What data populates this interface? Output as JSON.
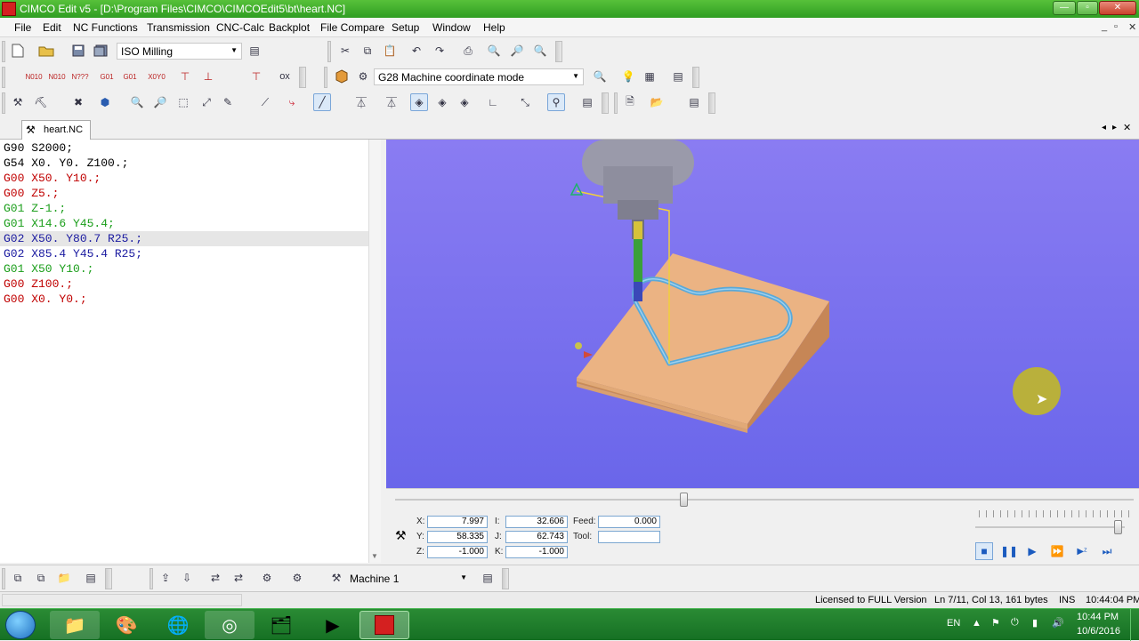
{
  "window": {
    "title": "CIMCO Edit v5 - [D:\\Program Files\\CIMCO\\CIMCOEdit5\\bt\\heart.NC]",
    "controls": [
      "—",
      "▫",
      "✕"
    ]
  },
  "menu": [
    "File",
    "Edit",
    "NC Functions",
    "Transmission",
    "CNC-Calc",
    "Backplot",
    "File Compare",
    "Setup",
    "Window",
    "Help"
  ],
  "mdi_controls": [
    "_",
    "▫",
    "✕"
  ],
  "toolbar1": {
    "mode_select": "ISO Milling"
  },
  "toolbar2": {
    "coord_select": "G28 Machine coordinate mode",
    "ox_label": "ox"
  },
  "doctab": {
    "name": "heart.NC",
    "nav": [
      "◂",
      "▸",
      "✕"
    ]
  },
  "code_lines": [
    {
      "text": "G90 S2000;",
      "color": "#000000"
    },
    {
      "text": "G54 X0. Y0. Z100.;",
      "color": "#000000"
    },
    {
      "text": "G00 X50. Y10.;",
      "color": "#c00000"
    },
    {
      "text": "G00 Z5.;",
      "color": "#c00000"
    },
    {
      "text": "G01 Z-1.;",
      "color": "#1a9e1a"
    },
    {
      "text": "G01 X14.6 Y45.4;",
      "color": "#1a9e1a"
    },
    {
      "text": "G02 X50. Y80.7 R25.;",
      "color": "#1a1aa0"
    },
    {
      "text": "G02 X85.4 Y45.4 R25;",
      "color": "#1a1aa0"
    },
    {
      "text": "G01 X50 Y10.;",
      "color": "#1a9e1a"
    },
    {
      "text": "G00 Z100.;",
      "color": "#c00000"
    },
    {
      "text": "G00 X0. Y0.;",
      "color": "#c00000"
    }
  ],
  "current_line_index": 6,
  "readout": {
    "x_label": "X:",
    "x": "7.997",
    "y_label": "Y:",
    "y": "58.335",
    "z_label": "Z:",
    "z": "-1.000",
    "i_label": "I:",
    "i": "32.606",
    "j_label": "J:",
    "j": "62.743",
    "k_label": "K:",
    "k": "-1.000",
    "feed_label": "Feed:",
    "feed": "0.000",
    "tool_label": "Tool:",
    "tool": ""
  },
  "playback": {
    "progress": 0.39,
    "speed": 0.95
  },
  "bottom_toolbar": {
    "machine_select": "Machine 1"
  },
  "status": {
    "license": "Licensed to FULL Version",
    "position": "Ln 7/11, Col 13, 161 bytes",
    "mode": "INS",
    "time": "10:44:04 PM"
  },
  "taskbar": {
    "lang": "EN",
    "clock_time": "10:44 PM",
    "clock_date": "10/6/2016"
  },
  "colors": {
    "titlebar": "#3fae2c",
    "viewport_bg": "#7a70ee",
    "stock": "#e8b07e",
    "toolpath": "#5aa9d8",
    "taskbar": "#1e7d2c"
  }
}
